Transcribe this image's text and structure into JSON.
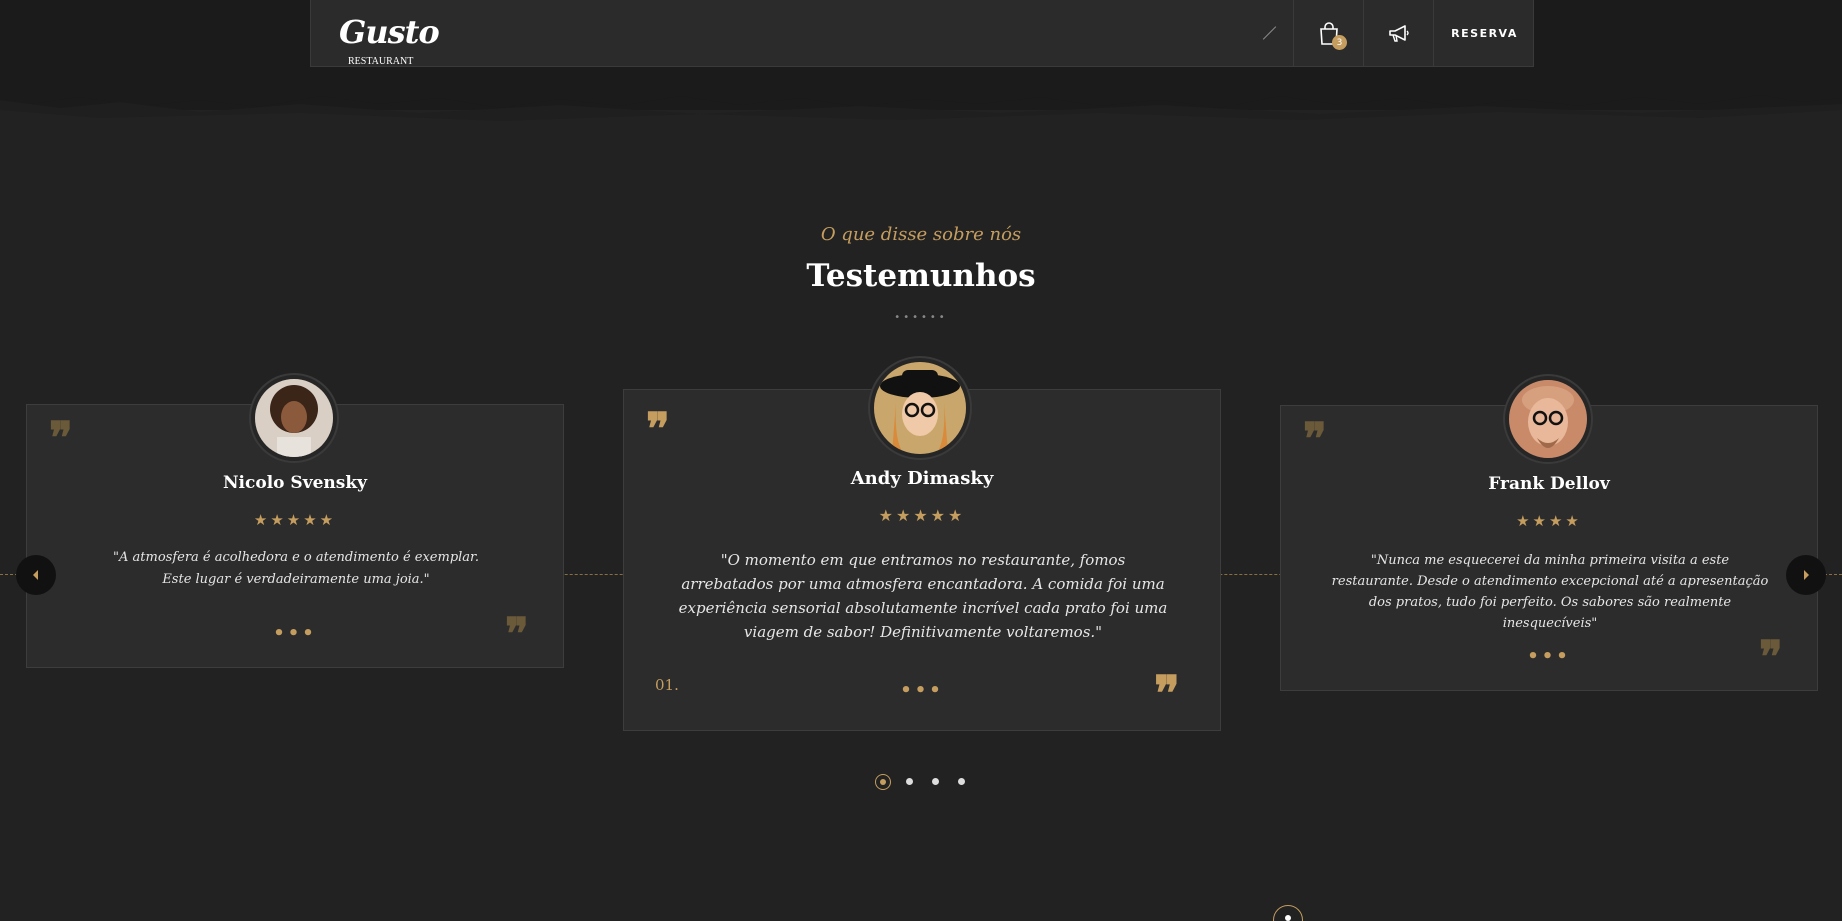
{
  "header": {
    "logo_text": "Gusto",
    "logo_subtext": "RESTAURANT",
    "cart_count": "3",
    "reserve_label": "RESERVA",
    "icons": [
      "slash-icon",
      "shopping-bag-icon",
      "megaphone-icon"
    ]
  },
  "section": {
    "subtitle": "O que disse sobre nós",
    "title": "Testemunhos",
    "dots": "••••••"
  },
  "testimonials": [
    {
      "name": "Nicolo Svensky",
      "stars": "★★★★★",
      "rating": 5,
      "text": "\"A atmosfera é acolhedora e o atendimento é exemplar. Este lugar é verdadeiramente uma joia.\"",
      "more": "•••"
    },
    {
      "name": "Andy Dimasky",
      "stars": "★★★★★",
      "rating": 5,
      "text": "\"O momento em que entramos no restaurante, fomos arrebatados por uma atmosfera encantadora. A comida foi uma experiência sensorial absolutamente incrível cada prato foi uma viagem de sabor! Definitivamente voltaremos.\"",
      "more": "•••",
      "index": "01."
    },
    {
      "name": "Frank Dellov",
      "stars": "★★★★",
      "rating": 4,
      "text": "\"Nunca me esquecerei da minha primeira visita a este restaurante. Desde o atendimento excepcional até a apresentação dos pratos, tudo foi perfeito. Os sabores são realmente inesquecíveis\"",
      "more": "•••"
    }
  ],
  "pagination": {
    "pages": 4,
    "active": 1
  },
  "colors": {
    "accent": "#c59d5f",
    "background": "#222222",
    "card": "#2c2c2c"
  }
}
